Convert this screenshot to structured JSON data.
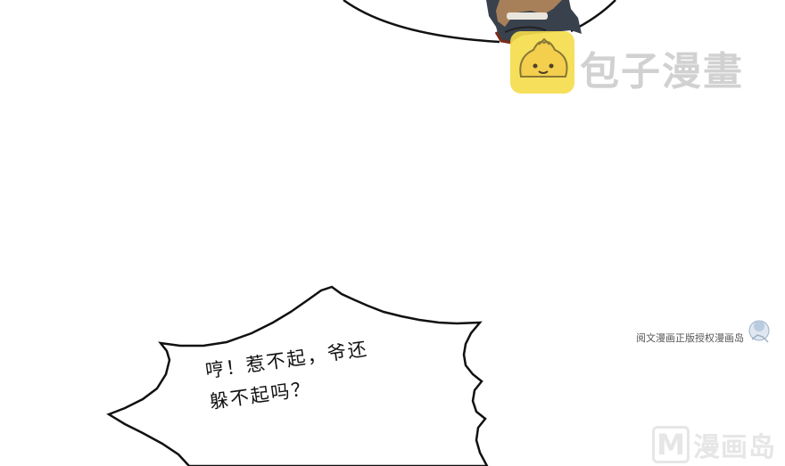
{
  "watermark": {
    "brand_text": "包子漫畫",
    "logo_icon": "steamed-bun-icon",
    "logo_color": "#f6dc4a"
  },
  "credit": {
    "text": "阅文漫画正版授权漫画岛",
    "icon": "mascot-icon"
  },
  "dialogue": {
    "line1": "哼！惹不起，爷还",
    "line2": "躲不起吗？"
  },
  "corner_watermark": {
    "letter": "M",
    "text": "漫画岛"
  }
}
